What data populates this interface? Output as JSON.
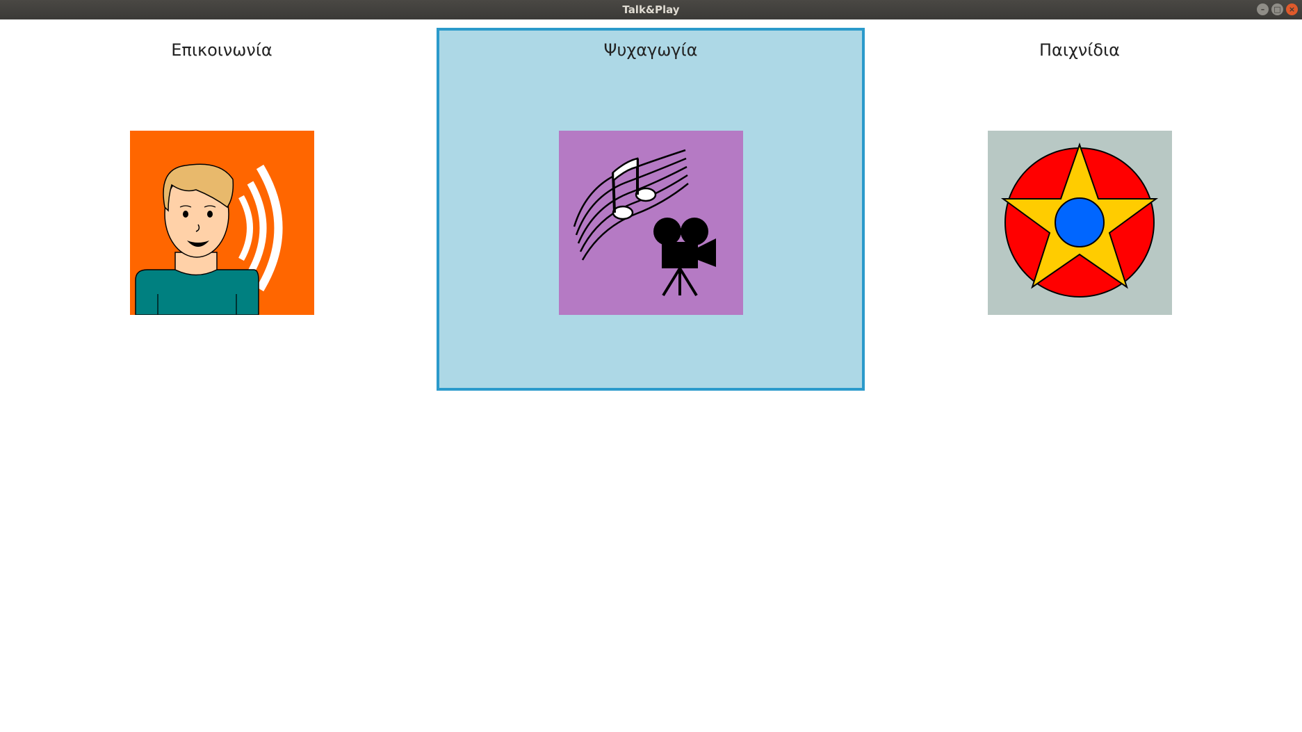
{
  "window": {
    "title": "Talk&Play",
    "controls": {
      "minimize": "–",
      "maximize": "□",
      "close": "×"
    }
  },
  "tiles": [
    {
      "label": "Επικοινωνία",
      "icon": "person-speaking-icon",
      "background": "#ff6600",
      "selected": false
    },
    {
      "label": "Ψυχαγωγία",
      "icon": "music-and-camera-icon",
      "background": "#b57ac4",
      "selected": true
    },
    {
      "label": "Παιχνίδια",
      "icon": "star-circle-icon",
      "background": "#b8c8c4",
      "selected": false
    }
  ],
  "colors": {
    "selection_fill": "#add8e6",
    "selection_border": "#2b9acb"
  }
}
